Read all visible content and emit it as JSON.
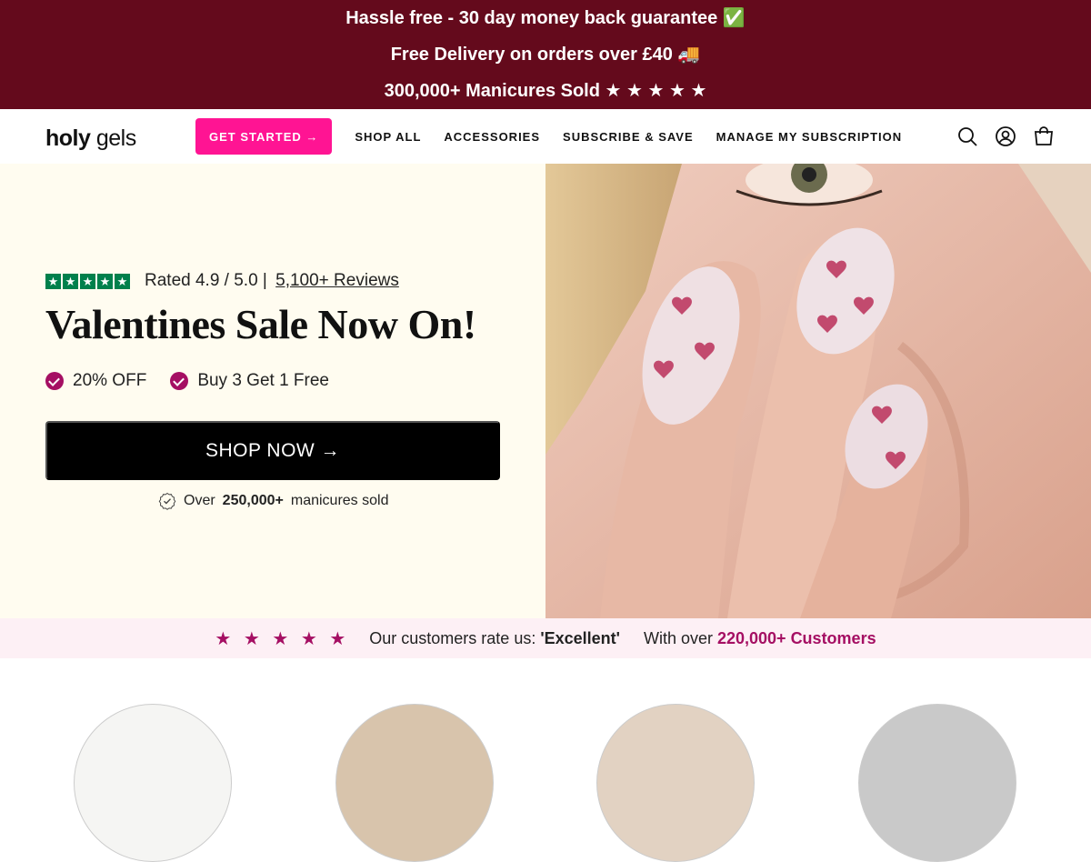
{
  "announcement": {
    "lines": [
      "Hassle free - 30 day money back guarantee ✅",
      "Free Delivery on orders over £40 🚚",
      "300,000+ Manicures Sold ★ ★ ★ ★ ★"
    ],
    "bg_color": "#640a1c"
  },
  "header": {
    "logo_bold": "holy",
    "logo_light": " gels",
    "get_started_label": "GET STARTED →",
    "nav": [
      "SHOP ALL",
      "ACCESSORIES",
      "SUBSCRIBE & SAVE",
      "MANAGE MY SUBSCRIPTION"
    ],
    "icons": [
      "search-icon",
      "account-icon",
      "cart-icon"
    ],
    "accent_color": "#ff1493"
  },
  "hero": {
    "rating_stars": 5,
    "rating_text": "Rated 4.9 / 5.0 |",
    "reviews_link": "5,100+ Reviews",
    "title": "Valentines Sale Now On!",
    "perks": [
      "20% OFF",
      "Buy 3 Get 1 Free"
    ],
    "shop_now": "SHOP NOW →",
    "sold_prefix": "Over",
    "sold_count": "250,000+",
    "sold_suffix": "manicures sold",
    "check_color": "#a50f63",
    "trustpilot_color": "#00804c"
  },
  "trust_bar": {
    "stars": "★ ★ ★ ★ ★",
    "rate_prefix": "Our customers rate us:",
    "rate_value": "'Excellent'",
    "customers_prefix": "With over",
    "customers_value": "220,000+ Customers",
    "accent_color": "#a50f63"
  }
}
